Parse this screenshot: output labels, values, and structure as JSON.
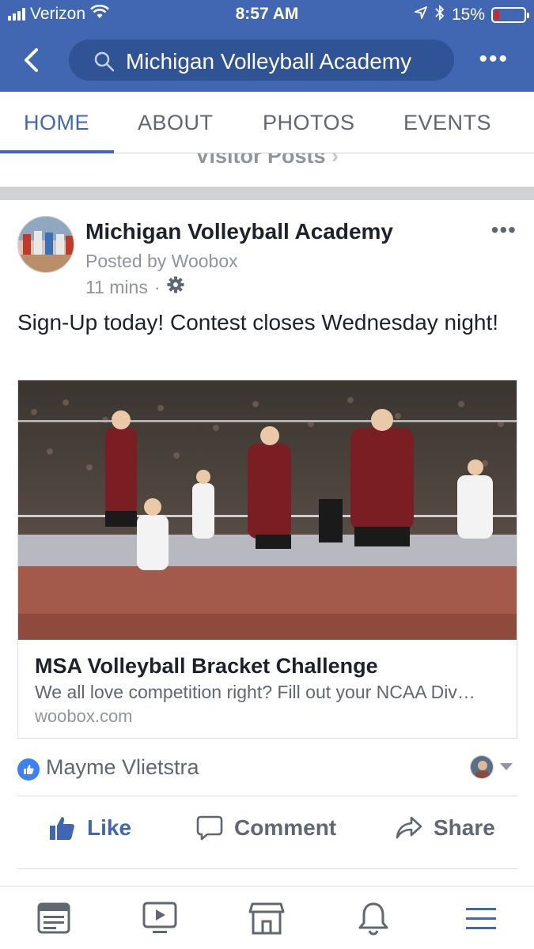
{
  "status_bar": {
    "carrier": "Verizon",
    "time": "8:57 AM",
    "battery_percent": "15%",
    "icons": [
      "signal-icon",
      "wifi-icon",
      "location-arrow-icon",
      "bluetooth-icon",
      "battery-icon"
    ]
  },
  "nav": {
    "search_query": "Michigan Volleyball Academy",
    "icons": [
      "back-arrow-icon",
      "search-icon",
      "more-icon"
    ]
  },
  "tabs": [
    {
      "label": "HOME",
      "active": true
    },
    {
      "label": "ABOUT",
      "active": false
    },
    {
      "label": "PHOTOS",
      "active": false
    },
    {
      "label": "EVENTS",
      "active": false
    }
  ],
  "visitor_posts_label": "Visitor Posts",
  "post": {
    "page_name": "Michigan Volleyball Academy",
    "posted_by": "Posted by Woobox",
    "time": "11 mins",
    "separator": "·",
    "text": "Sign-Up today! Contest closes Wednesday night!",
    "link": {
      "title": "MSA Volleyball Bracket Challenge",
      "description": "We all love competition right? Fill out your NCAA Div…",
      "domain": "woobox.com"
    },
    "reaction_by": "Mayme Vlietstra",
    "actions": {
      "like": "Like",
      "comment": "Comment",
      "share": "Share"
    }
  },
  "bottom_bar": {
    "icons": [
      "news-feed-icon",
      "watch-video-icon",
      "marketplace-icon",
      "notifications-bell-icon",
      "menu-icon"
    ]
  },
  "colors": {
    "brand_blue": "#4267b2",
    "search_bg": "#2f5394",
    "secondary_text": "#606770",
    "muted_text": "#90949c",
    "battery_low": "#e02020"
  }
}
